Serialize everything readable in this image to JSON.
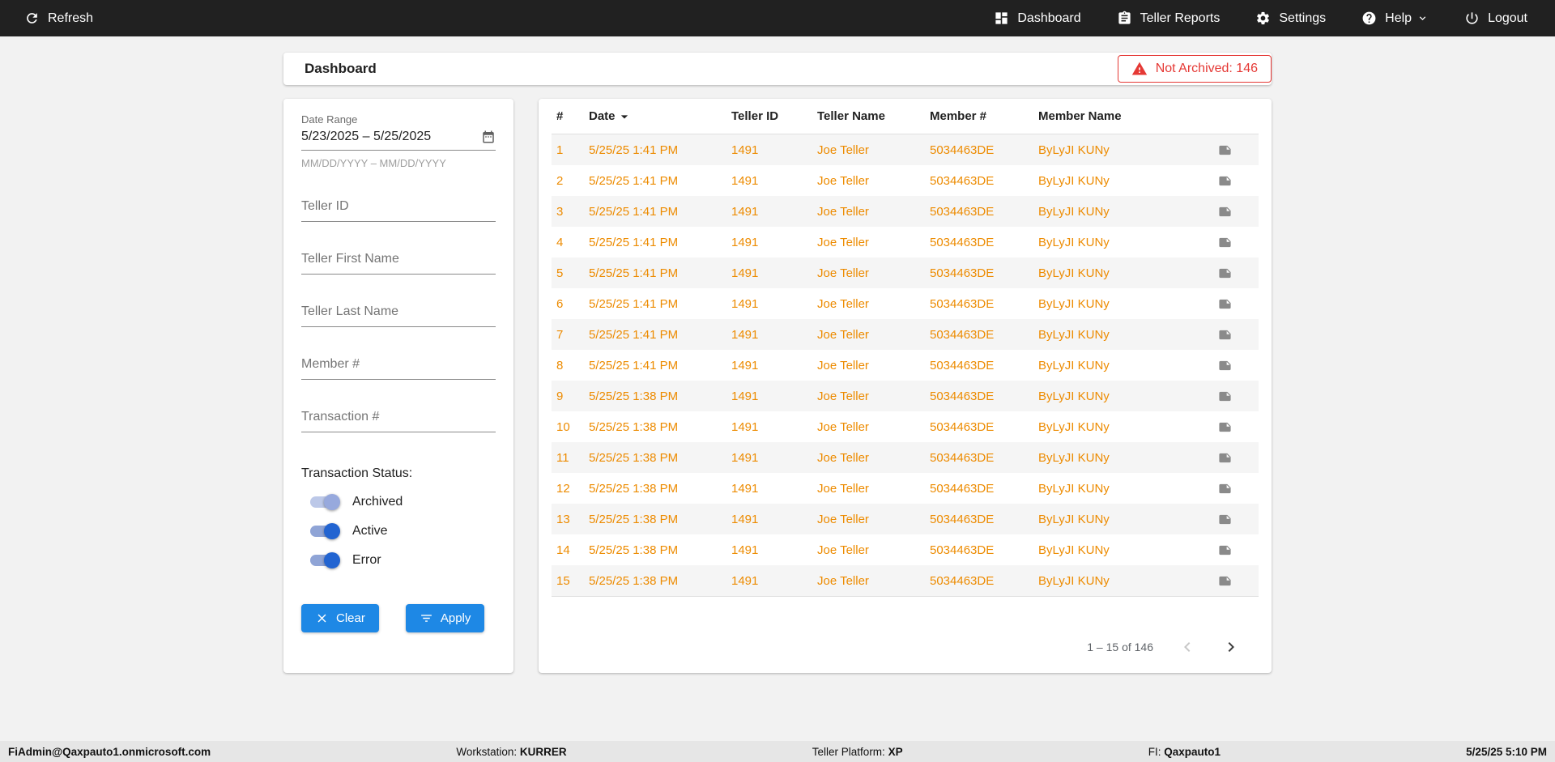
{
  "colors": {
    "topbar_bg": "#212121",
    "accent_blue": "#1E88E5",
    "data_orange": "#ED8B00",
    "alert_red": "#E53935",
    "toggle_blue": "#2264D1"
  },
  "topbar": {
    "refresh": {
      "label": "Refresh"
    },
    "items": [
      {
        "label": "Dashboard"
      },
      {
        "label": "Teller Reports"
      },
      {
        "label": "Settings"
      },
      {
        "label": "Help"
      },
      {
        "label": "Logout"
      }
    ]
  },
  "header": {
    "title": "Dashboard",
    "not_archived": "Not Archived: 146"
  },
  "filters": {
    "date_range": {
      "label": "Date Range",
      "value": "5/23/2025 – 5/25/2025",
      "hint": "MM/DD/YYYY – MM/DD/YYYY"
    },
    "teller_id": {
      "placeholder": "Teller ID"
    },
    "teller_first_name": {
      "placeholder": "Teller First Name"
    },
    "teller_last_name": {
      "placeholder": "Teller Last Name"
    },
    "member_number": {
      "placeholder": "Member #"
    },
    "transaction_number": {
      "placeholder": "Transaction #"
    },
    "status_label": "Transaction Status:",
    "toggles": [
      {
        "label": "Archived",
        "state": "on",
        "variant": "light"
      },
      {
        "label": "Active",
        "state": "on",
        "variant": "solid"
      },
      {
        "label": "Error",
        "state": "on",
        "variant": "solid"
      }
    ],
    "clear": "Clear",
    "apply": "Apply"
  },
  "table": {
    "columns": {
      "num": "#",
      "date": "Date",
      "teller_id": "Teller ID",
      "teller_name": "Teller Name",
      "member": "Member #",
      "member_name": "Member Name"
    },
    "sort": {
      "column": "Date",
      "direction": "desc"
    },
    "rows": [
      {
        "num": "1",
        "date": "5/25/25 1:41 PM",
        "teller_id": "1491",
        "teller_name": "Joe Teller",
        "member": "5034463DE",
        "member_name": "ByLyJI KUNy"
      },
      {
        "num": "2",
        "date": "5/25/25 1:41 PM",
        "teller_id": "1491",
        "teller_name": "Joe Teller",
        "member": "5034463DE",
        "member_name": "ByLyJI KUNy"
      },
      {
        "num": "3",
        "date": "5/25/25 1:41 PM",
        "teller_id": "1491",
        "teller_name": "Joe Teller",
        "member": "5034463DE",
        "member_name": "ByLyJI KUNy"
      },
      {
        "num": "4",
        "date": "5/25/25 1:41 PM",
        "teller_id": "1491",
        "teller_name": "Joe Teller",
        "member": "5034463DE",
        "member_name": "ByLyJI KUNy"
      },
      {
        "num": "5",
        "date": "5/25/25 1:41 PM",
        "teller_id": "1491",
        "teller_name": "Joe Teller",
        "member": "5034463DE",
        "member_name": "ByLyJI KUNy"
      },
      {
        "num": "6",
        "date": "5/25/25 1:41 PM",
        "teller_id": "1491",
        "teller_name": "Joe Teller",
        "member": "5034463DE",
        "member_name": "ByLyJI KUNy"
      },
      {
        "num": "7",
        "date": "5/25/25 1:41 PM",
        "teller_id": "1491",
        "teller_name": "Joe Teller",
        "member": "5034463DE",
        "member_name": "ByLyJI KUNy"
      },
      {
        "num": "8",
        "date": "5/25/25 1:41 PM",
        "teller_id": "1491",
        "teller_name": "Joe Teller",
        "member": "5034463DE",
        "member_name": "ByLyJI KUNy"
      },
      {
        "num": "9",
        "date": "5/25/25 1:38 PM",
        "teller_id": "1491",
        "teller_name": "Joe Teller",
        "member": "5034463DE",
        "member_name": "ByLyJI KUNy"
      },
      {
        "num": "10",
        "date": "5/25/25 1:38 PM",
        "teller_id": "1491",
        "teller_name": "Joe Teller",
        "member": "5034463DE",
        "member_name": "ByLyJI KUNy"
      },
      {
        "num": "11",
        "date": "5/25/25 1:38 PM",
        "teller_id": "1491",
        "teller_name": "Joe Teller",
        "member": "5034463DE",
        "member_name": "ByLyJI KUNy"
      },
      {
        "num": "12",
        "date": "5/25/25 1:38 PM",
        "teller_id": "1491",
        "teller_name": "Joe Teller",
        "member": "5034463DE",
        "member_name": "ByLyJI KUNy"
      },
      {
        "num": "13",
        "date": "5/25/25 1:38 PM",
        "teller_id": "1491",
        "teller_name": "Joe Teller",
        "member": "5034463DE",
        "member_name": "ByLyJI KUNy"
      },
      {
        "num": "14",
        "date": "5/25/25 1:38 PM",
        "teller_id": "1491",
        "teller_name": "Joe Teller",
        "member": "5034463DE",
        "member_name": "ByLyJI KUNy"
      },
      {
        "num": "15",
        "date": "5/25/25 1:38 PM",
        "teller_id": "1491",
        "teller_name": "Joe Teller",
        "member": "5034463DE",
        "member_name": "ByLyJI KUNy"
      }
    ],
    "pagination": {
      "range": "1 – 15 of 146"
    }
  },
  "statusbar": {
    "user": "FiAdmin@Qaxpauto1.onmicrosoft.com",
    "workstation_label": "Workstation:",
    "workstation_value": "KURRER",
    "platform_label": "Teller Platform:",
    "platform_value": "XP",
    "fi_label": "FI:",
    "fi_value": "Qaxpauto1",
    "datetime": "5/25/25 5:10 PM"
  }
}
